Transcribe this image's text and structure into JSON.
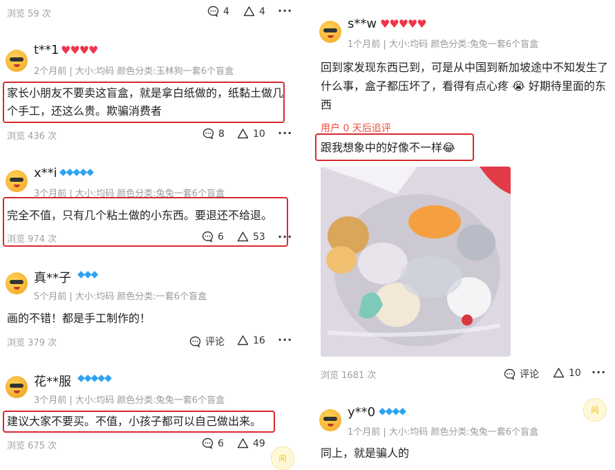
{
  "left": {
    "top_row": {
      "views": "浏览 59 次",
      "comments": "4",
      "likes": "4"
    },
    "reviews": [
      {
        "name": "t**1",
        "badge": "hearts",
        "meta": "2个月前 | 大小:均码 颜色分类:玉林狗一套6个盲盒",
        "text": "家长小朋友不要卖这盲盒，就是拿白纸做的，纸黏土做几个手工，还这么贵。欺骗消费者",
        "views": "浏览 436 次",
        "comments": "8",
        "likes": "10"
      },
      {
        "name": "x**i",
        "badge": "gems",
        "meta": "3个月前 | 大小:均码 颜色分类:兔兔一套6个盲盒",
        "text": "完全不值，只有几个粘土做的小东西。要退还不给退。",
        "views": "浏览 974 次",
        "comments": "6",
        "likes": "53"
      },
      {
        "name": "真**子",
        "badge": "gems",
        "meta": "5个月前 | 大小:均码 颜色分类:一套6个盲盒",
        "text": "画的不错！都是手工制作的！",
        "views": "浏览 379 次",
        "comments": "评论",
        "likes": "16"
      },
      {
        "name": "花**服",
        "badge": "gems",
        "meta": "3个月前 | 大小:均码 颜色分类:兔兔一套6个盲盒",
        "text": "建议大家不要买。不值，小孩子都可以自己做出来。",
        "views": "浏览 675 次",
        "comments": "6",
        "likes": "49"
      }
    ]
  },
  "right": {
    "reviews": [
      {
        "name": "s**w",
        "badge": "hearts",
        "meta": "1个月前 | 大小:均码 颜色分类:兔兔一套6个盲盒",
        "text": "回到家发现东西已到，可是从中国到新加坡途中不知发生了什么事，盒子都压坏了，看得有点心疼 😭 好期待里面的东西",
        "followup_label": "用户 0 天后追评",
        "followup_text": "跟我想象中的好像不一样😂",
        "views": "浏览 1681 次",
        "comments": "评论",
        "likes": "10"
      },
      {
        "name": "y**0",
        "badge": "gems",
        "meta": "1个月前 | 大小:均码 颜色分类:兔兔一套6个盲盒",
        "text": "同上，就是骗人的"
      }
    ]
  },
  "badges": {
    "hearts": "♥♥♥♥",
    "hearts5": "♥♥♥♥♥",
    "gems5": "◆◆◆◆◆",
    "gems3": "◆◆◆",
    "gems4": "◆◆◆◆"
  },
  "float_button_label": "问",
  "colors": {
    "highlight_box": "#d8282e",
    "followup": "#f04a3a",
    "hearts": "#f0344a",
    "gems": "#2ea3f2"
  }
}
